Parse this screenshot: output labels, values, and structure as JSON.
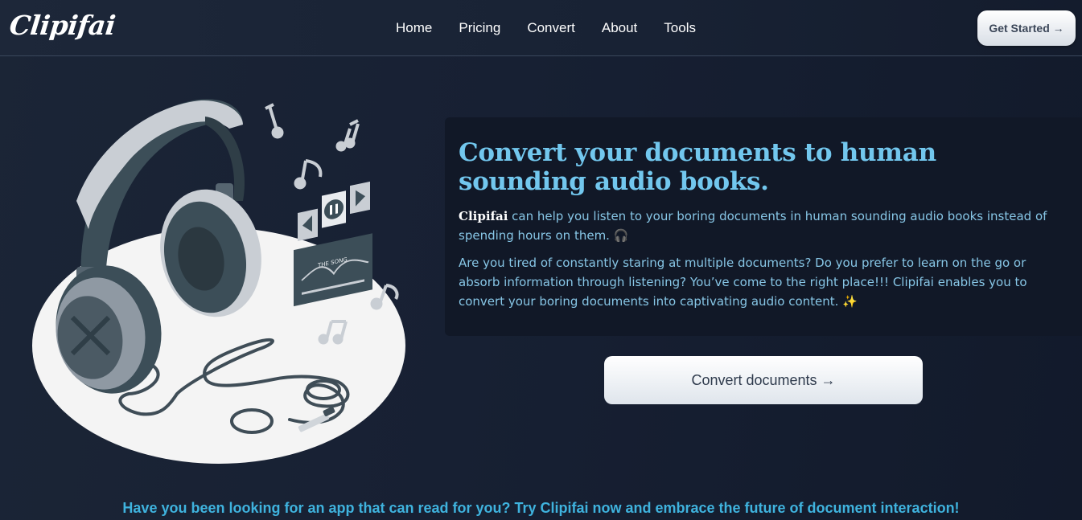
{
  "nav": {
    "logo": "Clipifai",
    "links": [
      "Home",
      "Pricing",
      "Convert",
      "About",
      "Tools"
    ],
    "cta_label": "Get Started →"
  },
  "hero": {
    "title": "Convert your documents to human sounding audio books.",
    "p1_brand": "Clipifai",
    "p1_text": " can help you listen to your boring documents in human sounding audio books instead of spending hours on them. 🎧",
    "p2_text": "Are you tired of constantly staring at multiple documents? Do you prefer to learn on the go or absorb information through listening? You’ve come to the right place!!! Clipifai enables you to convert your boring documents into captivating audio content. ✨",
    "button_label": "Convert documents →",
    "player_label": "THE SONG"
  },
  "tagline": "Have you been looking for an app that can read for you? Try Clipifai now and embrace the future of document interaction!"
}
